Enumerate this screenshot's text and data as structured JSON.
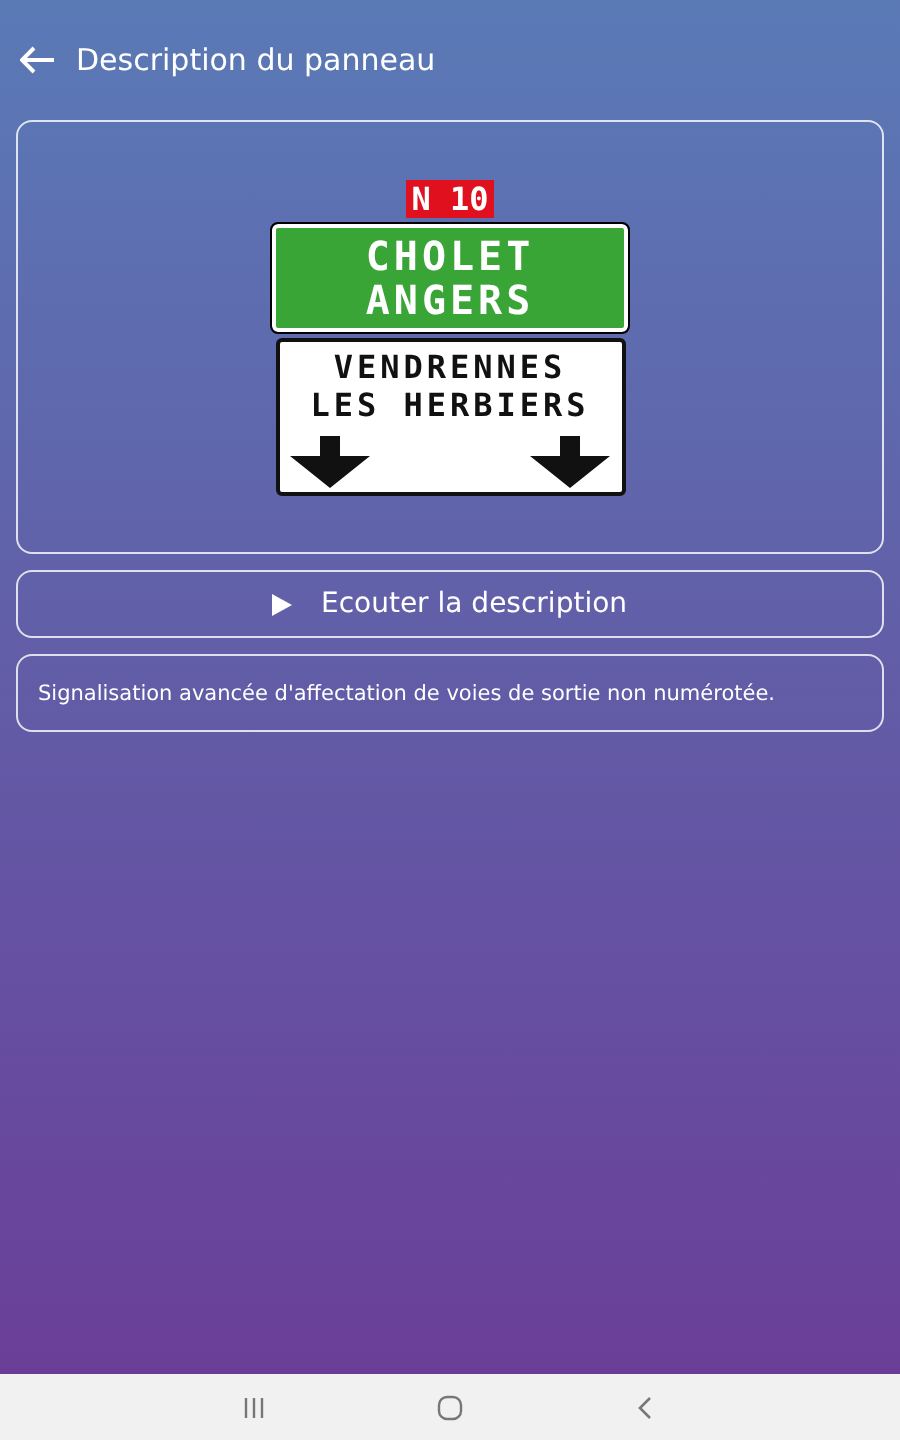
{
  "header": {
    "title": "Description du panneau"
  },
  "sign": {
    "route": "N 10",
    "green_lines": [
      "CHOLET",
      "ANGERS"
    ],
    "white_lines": [
      "VENDRENNES",
      "LES HERBIERS"
    ]
  },
  "listen_button": {
    "label": "Ecouter la description"
  },
  "description": "Signalisation avancée d'affectation de voies de sortie non numérotée."
}
